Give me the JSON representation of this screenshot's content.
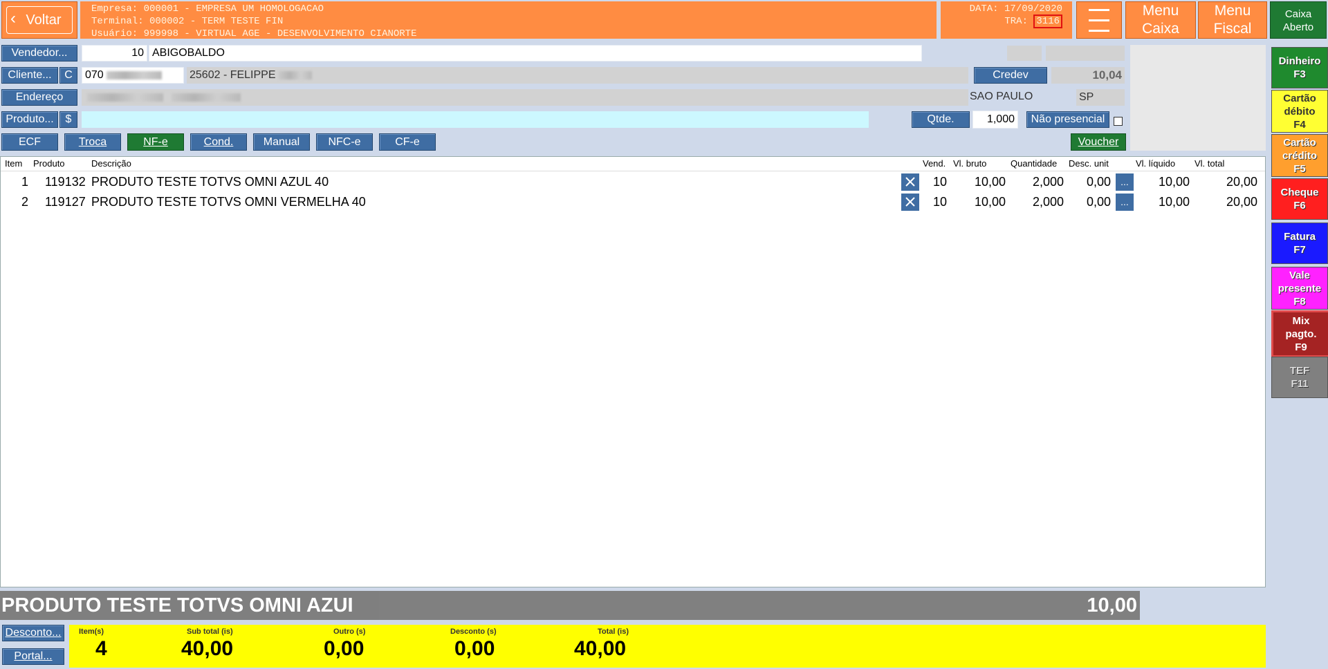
{
  "header": {
    "back_label": "Voltar",
    "info_lines": [
      "Empresa: 000001 - EMPRESA UM HOMOLOGACAO",
      "Terminal: 000002 - TERM TESTE FIN",
      "Usuário: 999998 - VIRTUAL AGE - DESENVOLVIMENTO CIANORTE"
    ],
    "date_label": "DATA: 17/09/2020",
    "tra_label": "TRA:",
    "tra_value": "3116",
    "menu_caixa": [
      "Menu",
      "Caixa"
    ],
    "menu_fiscal": [
      "Menu",
      "Fiscal"
    ],
    "caixa_status": [
      "Caixa",
      "Aberto"
    ]
  },
  "form": {
    "vendedor_label": "Vendedor...",
    "vendedor_code": "10",
    "vendedor_name": "ABIGOBALDO",
    "cliente_label": "Cliente...",
    "cliente_c_label": "C",
    "cliente_doc": "070",
    "cliente_name": "25602 - FELIPPE",
    "credev_label": "Credev",
    "credev_value": "10,04",
    "endereco_label": "Endereço",
    "cidade": "SAO PAULO",
    "uf": "SP",
    "produto_label": "Produto...",
    "produto_dollar": "$",
    "produto_value": "",
    "qtde_label": "Qtde.",
    "qtde_value": "1,000",
    "nao_presencial_label": "Não presencial"
  },
  "doc_buttons": {
    "ecf": "ECF",
    "troca": "Troca",
    "nfe": "NF-e",
    "cond": "Cond.",
    "manual": "Manual",
    "nfce": "NFC-e",
    "cfe": "CF-e",
    "voucher": "Voucher"
  },
  "table": {
    "headers": {
      "item": "Item",
      "produto": "Produto",
      "descricao": "Descrição",
      "vend": "Vend.",
      "vl_bruto": "Vl. bruto",
      "quantidade": "Quantidade",
      "desc_unit": "Desc. unit",
      "vl_liquido": "Vl. líquido",
      "vl_total": "Vl. total"
    },
    "rows": [
      {
        "item": "1",
        "produto": "119132",
        "descricao": "PRODUTO TESTE TOTVS OMNI AZUL 40",
        "vend": "10",
        "vl_bruto": "10,00",
        "quantidade": "2,000",
        "desc_unit": "0,00",
        "more": "...",
        "vl_liquido": "10,00",
        "vl_total": "20,00"
      },
      {
        "item": "2",
        "produto": "119127",
        "descricao": "PRODUTO TESTE TOTVS OMNI VERMELHA 40",
        "vend": "10",
        "vl_bruto": "10,00",
        "quantidade": "2,000",
        "desc_unit": "0,00",
        "more": "...",
        "vl_liquido": "10,00",
        "vl_total": "20,00"
      }
    ]
  },
  "current_item": {
    "description": "PRODUTO TESTE TOTVS OMNI AZUI",
    "value": "10,00"
  },
  "footer": {
    "desconto_label": "Desconto...",
    "portal_label": "Portal...",
    "items_label": "Item(s)",
    "items_value": "4",
    "subtotal_label": "Sub total (is)",
    "subtotal_value": "40,00",
    "outro_label": "Outro (s)",
    "outro_value": "0,00",
    "desconto_tot_label": "Desconto (s)",
    "desconto_tot_value": "0,00",
    "total_label": "Total (is)",
    "total_value": "40,00"
  },
  "payments": [
    {
      "line1": "Dinheiro",
      "line2": "F3",
      "line3": ""
    },
    {
      "line1": "Cartão",
      "line2": "débito",
      "line3": "F4"
    },
    {
      "line1": "Cartão",
      "line2": "crédito",
      "line3": "F5"
    },
    {
      "line1": "Cheque",
      "line2": "F6",
      "line3": ""
    },
    {
      "line1": "Fatura",
      "line2": "F7",
      "line3": ""
    },
    {
      "line1": "Vale",
      "line2": "presente",
      "line3": "F8"
    },
    {
      "line1": "Mix",
      "line2": "pagto.",
      "line3": "F9"
    },
    {
      "line1": "TEF",
      "line2": "F11",
      "line3": ""
    }
  ],
  "colors": {
    "header_orange": "#ff8c42",
    "button_blue": "#3f6da3",
    "button_green": "#1f7a33",
    "footer_yellow": "#ffff00",
    "dinheiro": "#1f8a2e",
    "debito": "#ffff33",
    "credito": "#ff9f2e",
    "cheque": "#ff1f1f",
    "fatura": "#1a1aff",
    "vale": "#ff22ff",
    "mix": "#a52323",
    "tef": "#808080"
  }
}
